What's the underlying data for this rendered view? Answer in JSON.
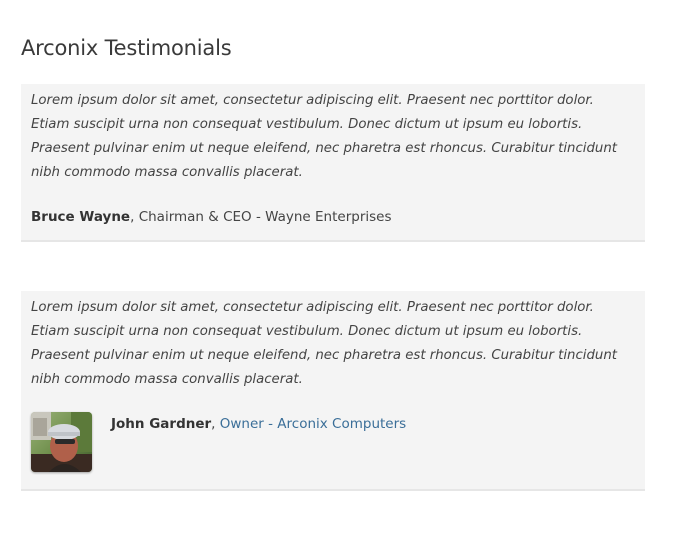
{
  "page": {
    "title": "Arconix Testimonials"
  },
  "testimonials": [
    {
      "quote": "Lorem ipsum dolor sit amet, consectetur adipiscing elit. Praesent nec porttitor dolor. Etiam suscipit urna non consequat vestibulum. Donec dictum ut ipsum eu lobortis. Praesent pulvinar enim ut neque eleifend, nec pharetra est rhoncus. Curabitur tincidunt nibh commodo massa convallis placerat.",
      "author": "Bruce Wayne",
      "separator": ", ",
      "byline": "Chairman & CEO - Wayne Enterprises",
      "has_avatar": false
    },
    {
      "quote": "Lorem ipsum dolor sit amet, consectetur adipiscing elit. Praesent nec porttitor dolor. Etiam suscipit urna non consequat vestibulum. Donec dictum ut ipsum eu lobortis. Praesent pulvinar enim ut neque eleifend, nec pharetra est rhoncus. Curabitur tincidunt nibh commodo massa convallis placerat.",
      "author": "John Gardner",
      "separator": ", ",
      "byline": "Owner - Arconix Computers",
      "byline_is_link": true,
      "has_avatar": true
    }
  ],
  "colors": {
    "card_background": "#f4f4f4",
    "card_border": "#e6e6e6",
    "link": "#3a6e98",
    "text": "#444444"
  }
}
